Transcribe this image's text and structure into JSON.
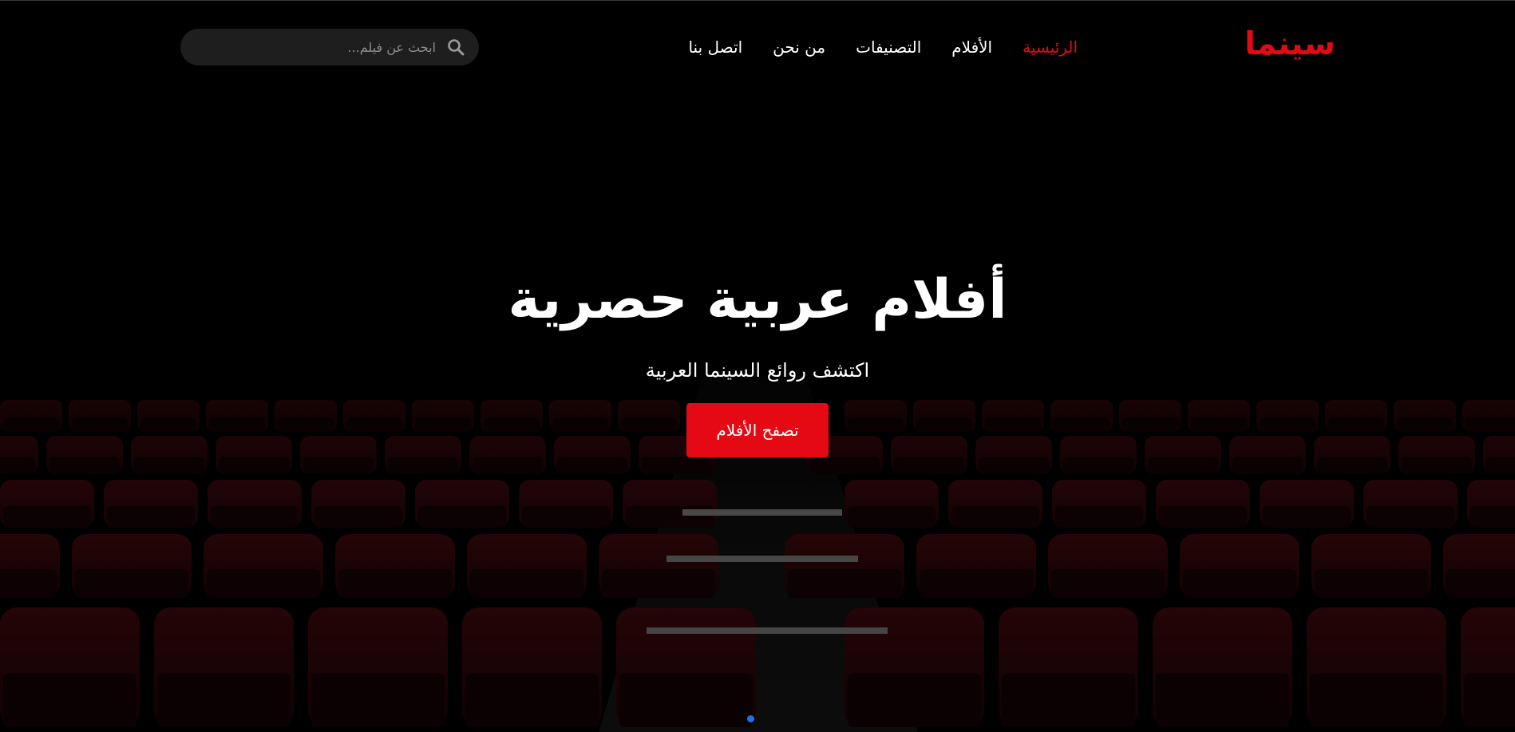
{
  "header": {
    "logo": "سينما",
    "nav": [
      {
        "label": "الرئيسية",
        "active": true
      },
      {
        "label": "الأفلام",
        "active": false
      },
      {
        "label": "التصنيفات",
        "active": false
      },
      {
        "label": "من نحن",
        "active": false
      },
      {
        "label": "اتصل بنا",
        "active": false
      }
    ],
    "search": {
      "placeholder": "ابحث عن فيلم...",
      "value": "",
      "icon": "search-icon"
    }
  },
  "hero": {
    "title": "أفلام عربية حصرية",
    "subtitle": "اكتشف روائع السينما العربية",
    "cta_label": "تصفح الأفلام"
  },
  "carousel": {
    "slide_count": 1,
    "active_index": 0
  },
  "colors": {
    "accent": "#e50914",
    "background": "#000000",
    "seat": "#2a0508",
    "dot": "#1a73e8"
  }
}
